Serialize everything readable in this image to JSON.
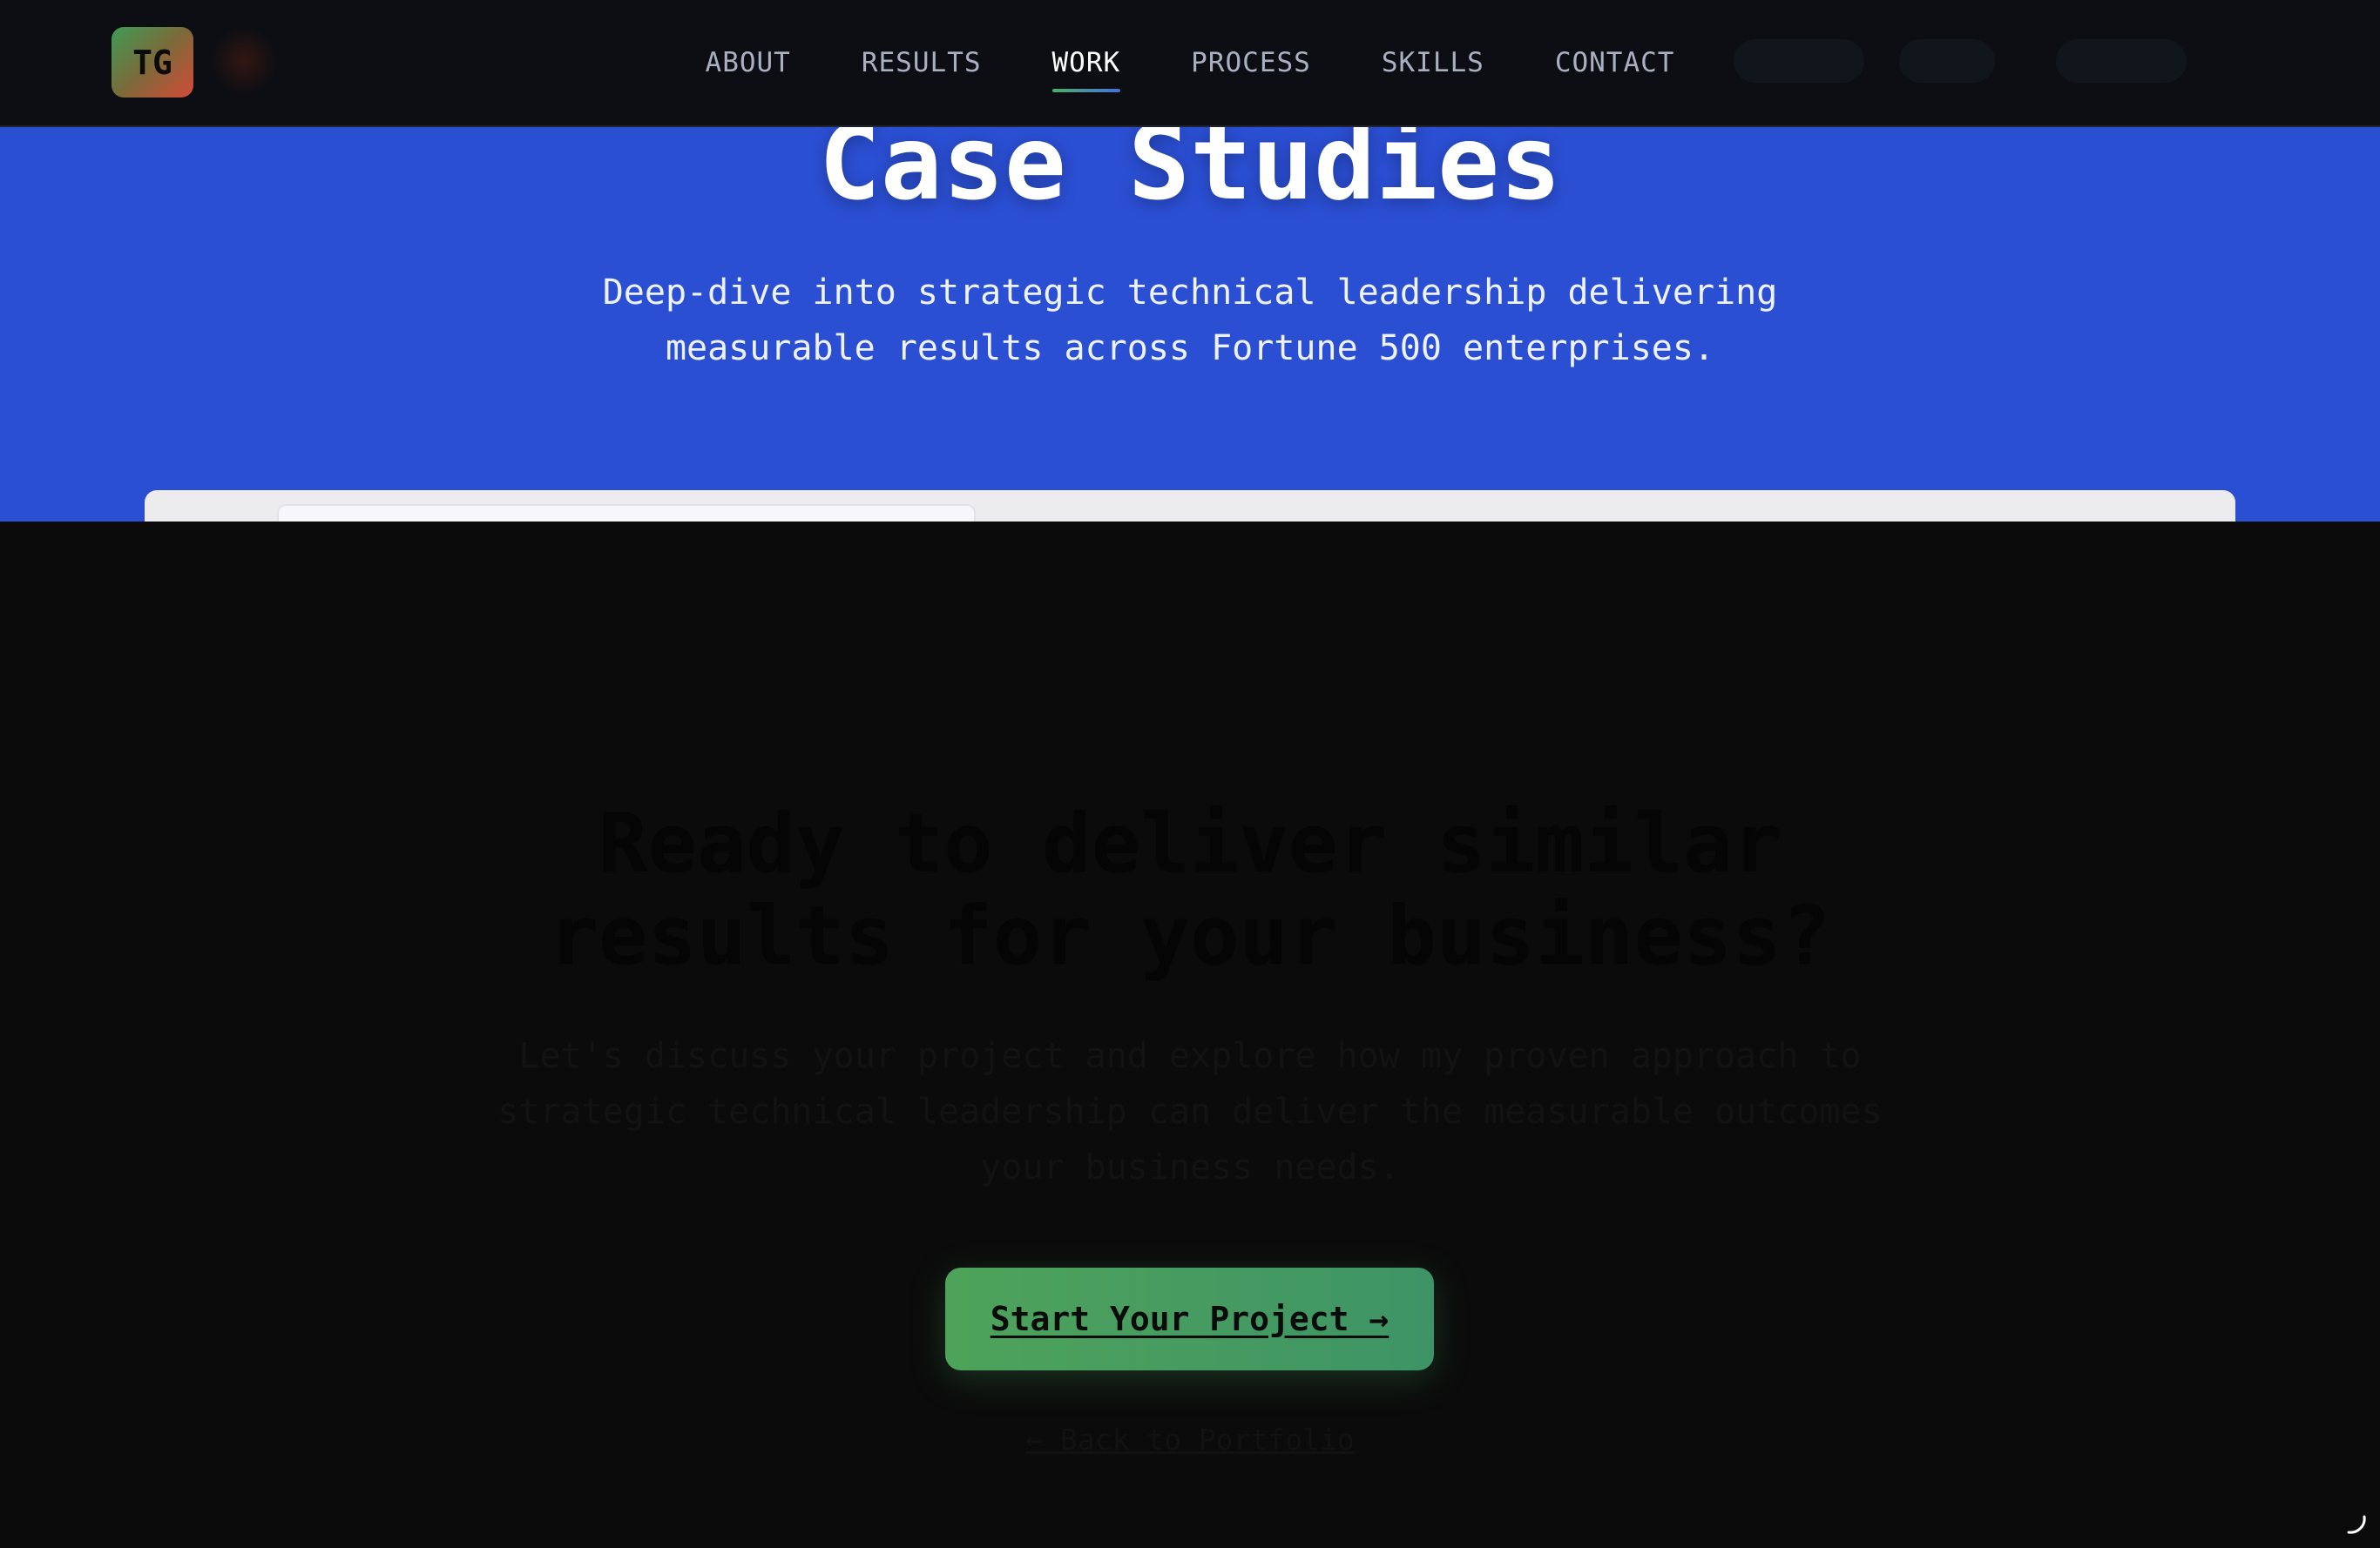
{
  "navbar": {
    "logo_text": "TG",
    "links": [
      {
        "label": "ABOUT",
        "active": false
      },
      {
        "label": "RESULTS",
        "active": false
      },
      {
        "label": "WORK",
        "active": true
      },
      {
        "label": "PROCESS",
        "active": false
      },
      {
        "label": "SKILLS",
        "active": false
      },
      {
        "label": "CONTACT",
        "active": false
      }
    ]
  },
  "hero": {
    "title": "Case Studies",
    "subtitle": "Deep-dive into strategic technical leadership delivering measurable results across Fortune 500 enterprises."
  },
  "cta": {
    "title": "Ready to deliver similar results for your business?",
    "text": "Let's discuss your project and explore how my proven approach to strategic technical leadership can deliver the measurable outcomes your business needs.",
    "button_label": "Start Your Project →",
    "back_link_label": "← Back to Portfolio"
  },
  "colors": {
    "hero_background": "#2b4fd3",
    "nav_background": "#0c0e13",
    "page_background": "#0b0b0b",
    "button_green": "#4ea35a"
  },
  "icons": {
    "loading": "spinner-icon"
  }
}
